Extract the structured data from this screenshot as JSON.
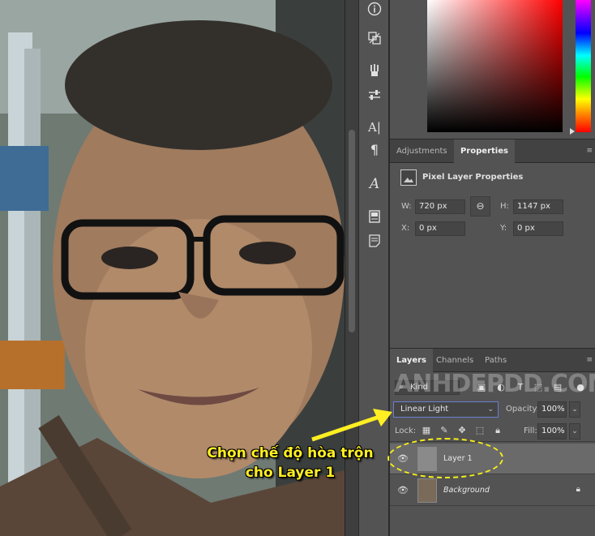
{
  "toolbar": {
    "icons": [
      "info-icon",
      "history-icon",
      "brushes-icon",
      "adjust-sliders-icon",
      "character-icon",
      "paragraph-icon",
      "glyphs-icon",
      "libraries-icon",
      "notes-icon"
    ],
    "labels": {
      "character": "A|",
      "paragraph": "¶",
      "glyphs": "A"
    }
  },
  "properties": {
    "tabs": [
      {
        "label": "Adjustments",
        "active": false
      },
      {
        "label": "Properties",
        "active": true
      }
    ],
    "title": "Pixel Layer Properties",
    "w_label": "W:",
    "w_value": "720 px",
    "h_label": "H:",
    "h_value": "1147 px",
    "x_label": "X:",
    "x_value": "0 px",
    "y_label": "Y:",
    "y_value": "0 px"
  },
  "layers_panel": {
    "tabs": [
      {
        "label": "Layers",
        "active": true
      },
      {
        "label": "Channels",
        "active": false
      },
      {
        "label": "Paths",
        "active": false
      }
    ],
    "kind_label": "Kind",
    "blend_mode": "Linear Light",
    "opacity_label": "Opacity:",
    "opacity_value": "100%",
    "lock_label": "Lock:",
    "fill_label": "Fill:",
    "fill_value": "100%",
    "layers": [
      {
        "name": "Layer 1",
        "selected": true,
        "thumb_color": "#8a8a8a",
        "visible": true,
        "locked": false
      },
      {
        "name": "Background",
        "selected": false,
        "thumb_color": "#7a6a5a",
        "visible": true,
        "locked": true
      }
    ]
  },
  "annotation": {
    "line1": "Chọn chế độ hòa trộn",
    "line2": "cho Layer 1",
    "color": "#ffef22"
  },
  "watermark": "ANHDEPDD.COM"
}
